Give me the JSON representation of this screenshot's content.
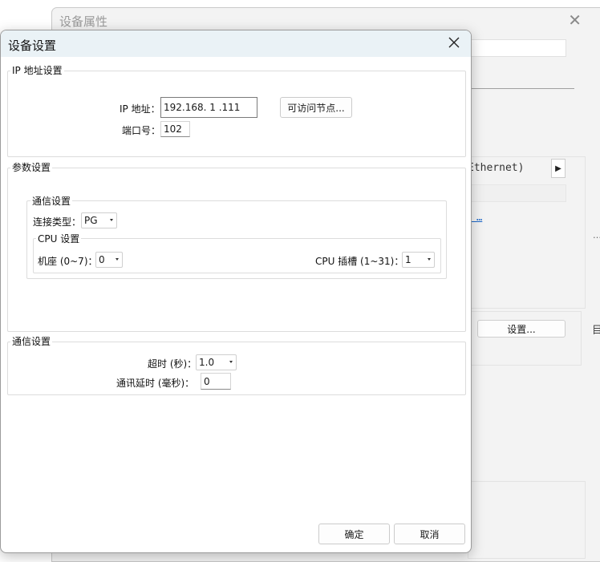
{
  "background_window": {
    "title": "设备属性",
    "ethernet_text": "Ethernet)",
    "arrow": "▶",
    "link_text": "ᅟ…",
    "settings_button": "设置...",
    "edge_char": "目",
    "dots": "…"
  },
  "dialog": {
    "title": "设备设置",
    "ip_group": {
      "legend": "IP 地址设置",
      "ip_label": "IP 地址：",
      "ip_value": "192.168. 1 .111",
      "accessible_nodes_button": "可访问节点...",
      "port_label": "端口号：",
      "port_value": "102"
    },
    "param_group": {
      "legend": "参数设置",
      "comm_group": {
        "legend": "通信设置",
        "conn_type_label": "连接类型：",
        "conn_type_value": "PG",
        "cpu_group": {
          "legend": "CPU 设置",
          "rack_label": "机座 (0~7)：",
          "rack_value": "0",
          "slot_label": "CPU 插槽 (1~31)：",
          "slot_value": "1"
        }
      }
    },
    "comm_settings_group": {
      "legend": "通信设置",
      "timeout_label": "超时 (秒)：",
      "timeout_value": "1.0",
      "delay_label": "通讯延时 (毫秒)：",
      "delay_value": "0"
    },
    "ok_button": "确定",
    "cancel_button": "取消"
  }
}
